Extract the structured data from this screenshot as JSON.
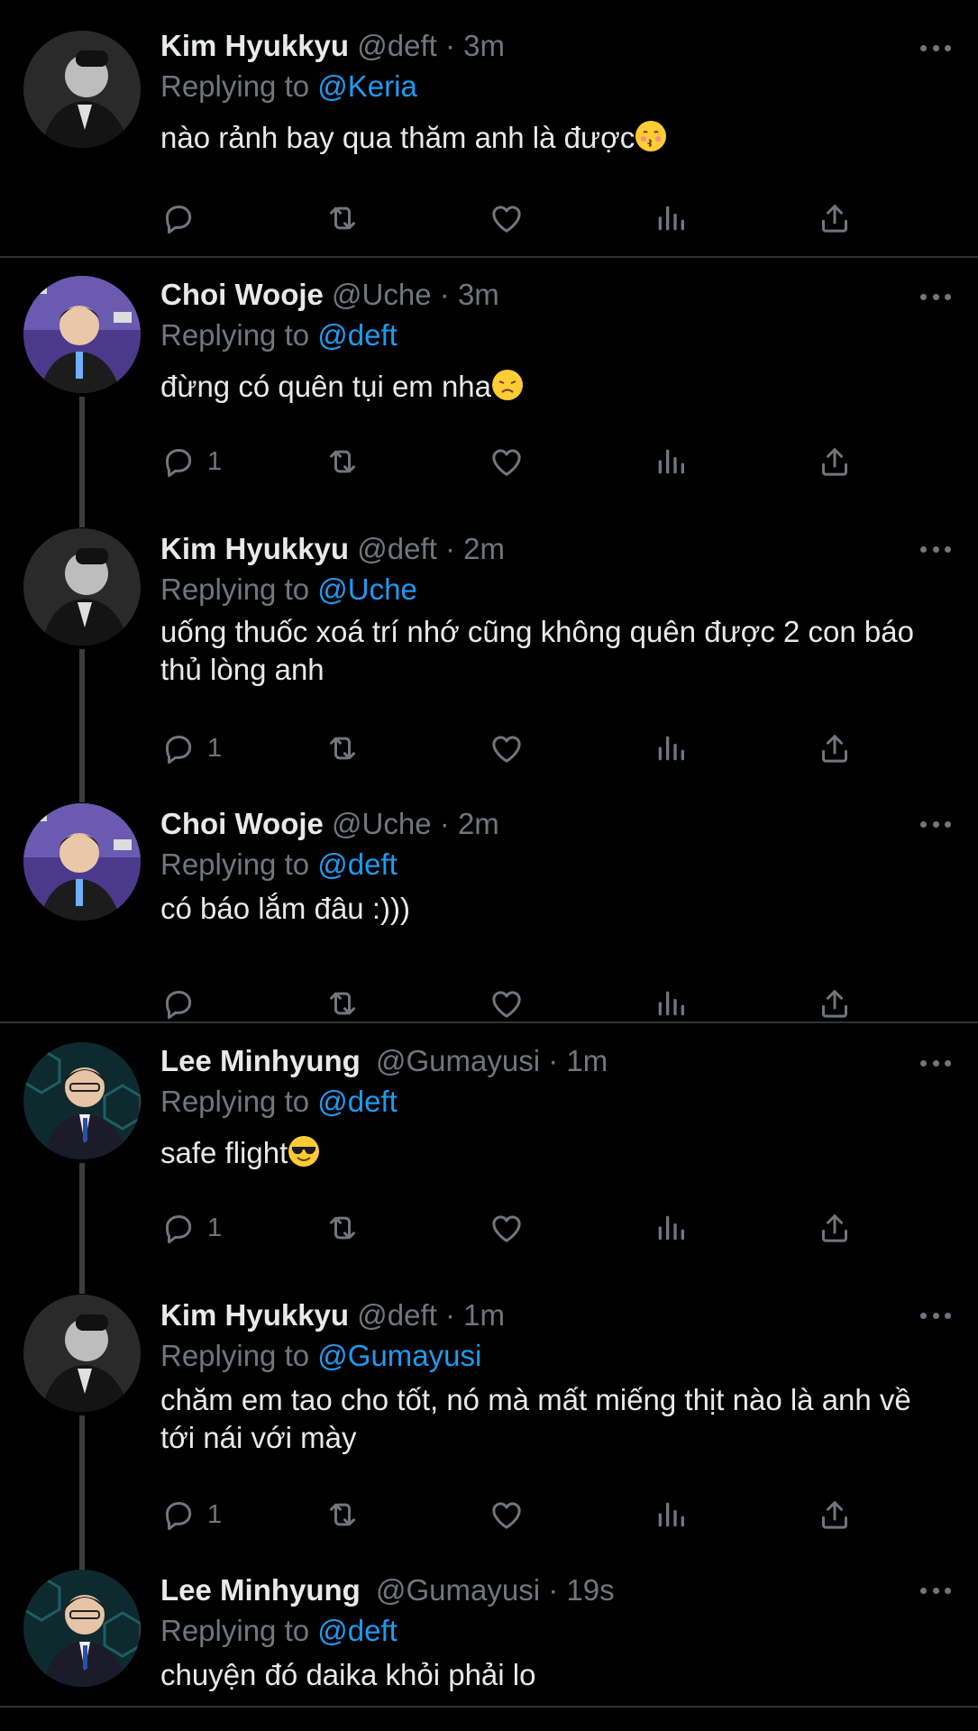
{
  "tweets": [
    {
      "name": "Kim Hyukkyu",
      "handle": "@deft",
      "dot": "·",
      "time": "3m",
      "replying_prefix": "Replying to",
      "mention": "@Keria",
      "text": "nào rảnh bay qua thăm anh là được",
      "emoji": "kissing-face",
      "reply_count": ""
    },
    {
      "name": "Choi Wooje",
      "handle": "@Uche",
      "dot": "·",
      "time": "3m",
      "replying_prefix": "Replying to",
      "mention": "@deft",
      "text": "đừng có quên tụi em nha",
      "emoji": "disappointed-face",
      "reply_count": "1"
    },
    {
      "name": "Kim Hyukkyu",
      "handle": "@deft",
      "dot": "·",
      "time": "2m",
      "replying_prefix": "Replying to",
      "mention": "@Uche",
      "text": "uống thuốc xoá trí nhớ cũng không quên được 2 con báo thủ lòng anh",
      "emoji": "",
      "reply_count": "1"
    },
    {
      "name": "Choi Wooje",
      "handle": "@Uche",
      "dot": "·",
      "time": "2m",
      "replying_prefix": "Replying to",
      "mention": "@deft",
      "text": "có báo lắm đâu :)))",
      "emoji": "",
      "reply_count": ""
    },
    {
      "name": "Lee Minhyung",
      "handle": "@Gumayusi",
      "dot": "·",
      "time": "1m",
      "replying_prefix": "Replying to",
      "mention": "@deft",
      "text": "safe flight",
      "emoji": "sunglasses-face",
      "reply_count": "1"
    },
    {
      "name": "Kim Hyukkyu",
      "handle": "@deft",
      "dot": "·",
      "time": "1m",
      "replying_prefix": "Replying to",
      "mention": "@Gumayusi",
      "text": "chăm em tao cho tốt, nó mà mất miếng thịt nào là anh về tới nái với mày",
      "emoji": "",
      "reply_count": "1"
    },
    {
      "name": "Lee Minhyung",
      "handle": "@Gumayusi",
      "dot": "·",
      "time": "19s",
      "replying_prefix": "Replying to",
      "mention": "@deft",
      "text": "chuyện đó daika khỏi phải lo",
      "emoji": "",
      "reply_count": ""
    }
  ],
  "icons": {
    "reply": "reply-icon",
    "retweet": "retweet-icon",
    "like": "like-icon",
    "views": "views-icon",
    "share": "share-icon",
    "more": "more-icon"
  },
  "colors": {
    "background": "#000000",
    "text": "#e7e9ea",
    "muted": "#71767b",
    "mention": "#1d9bf0",
    "divider": "#2f3336"
  }
}
